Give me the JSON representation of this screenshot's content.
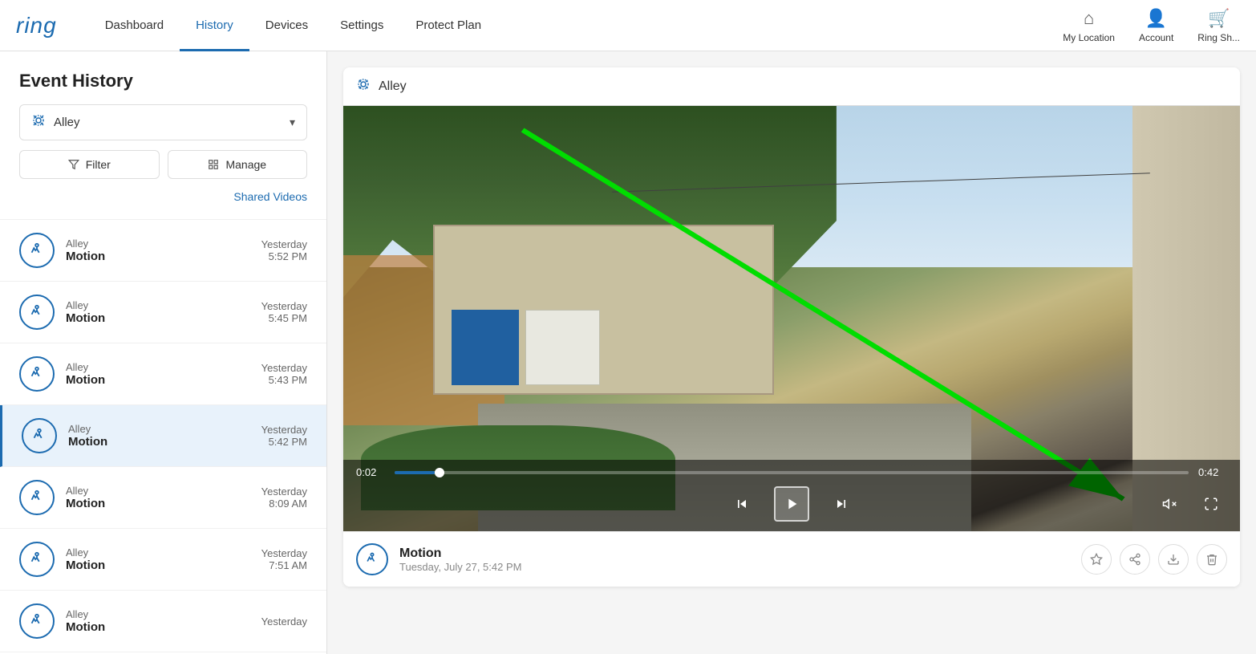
{
  "header": {
    "logo": "ring",
    "nav": [
      {
        "label": "Dashboard",
        "active": false
      },
      {
        "label": "History",
        "active": true
      },
      {
        "label": "Devices",
        "active": false
      },
      {
        "label": "Settings",
        "active": false
      },
      {
        "label": "Protect Plan",
        "active": false
      }
    ],
    "right_buttons": [
      {
        "label": "My Location",
        "icon": "home-icon"
      },
      {
        "label": "Account",
        "icon": "account-icon"
      },
      {
        "label": "Ring Sh...",
        "icon": "ringshare-icon"
      }
    ]
  },
  "sidebar": {
    "title": "Event History",
    "device_selector": {
      "label": "Alley",
      "icon": "camera-icon"
    },
    "filter_label": "Filter",
    "manage_label": "Manage",
    "shared_videos_label": "Shared Videos",
    "events": [
      {
        "camera": "Alley",
        "type": "Motion",
        "date": "Yesterday",
        "time": "5:52 PM",
        "selected": false
      },
      {
        "camera": "Alley",
        "type": "Motion",
        "date": "Yesterday",
        "time": "5:45 PM",
        "selected": false
      },
      {
        "camera": "Alley",
        "type": "Motion",
        "date": "Yesterday",
        "time": "5:43 PM",
        "selected": false
      },
      {
        "camera": "Alley",
        "type": "Motion",
        "date": "Yesterday",
        "time": "5:42 PM",
        "selected": true
      },
      {
        "camera": "Alley",
        "type": "Motion",
        "date": "Yesterday",
        "time": "8:09 AM",
        "selected": false
      },
      {
        "camera": "Alley",
        "type": "Motion",
        "date": "Yesterday",
        "time": "7:51 AM",
        "selected": false
      },
      {
        "camera": "Alley",
        "type": "Motion",
        "date": "Yesterday",
        "time": "",
        "selected": false
      }
    ]
  },
  "video_player": {
    "camera_name": "Alley",
    "current_time": "0:02",
    "total_time": "0:42",
    "progress_percent": 5,
    "event_type": "Motion",
    "event_datetime": "Tuesday, July 27, 5:42 PM"
  },
  "actions": {
    "star_label": "star",
    "share_label": "share",
    "download_label": "download",
    "delete_label": "delete"
  }
}
